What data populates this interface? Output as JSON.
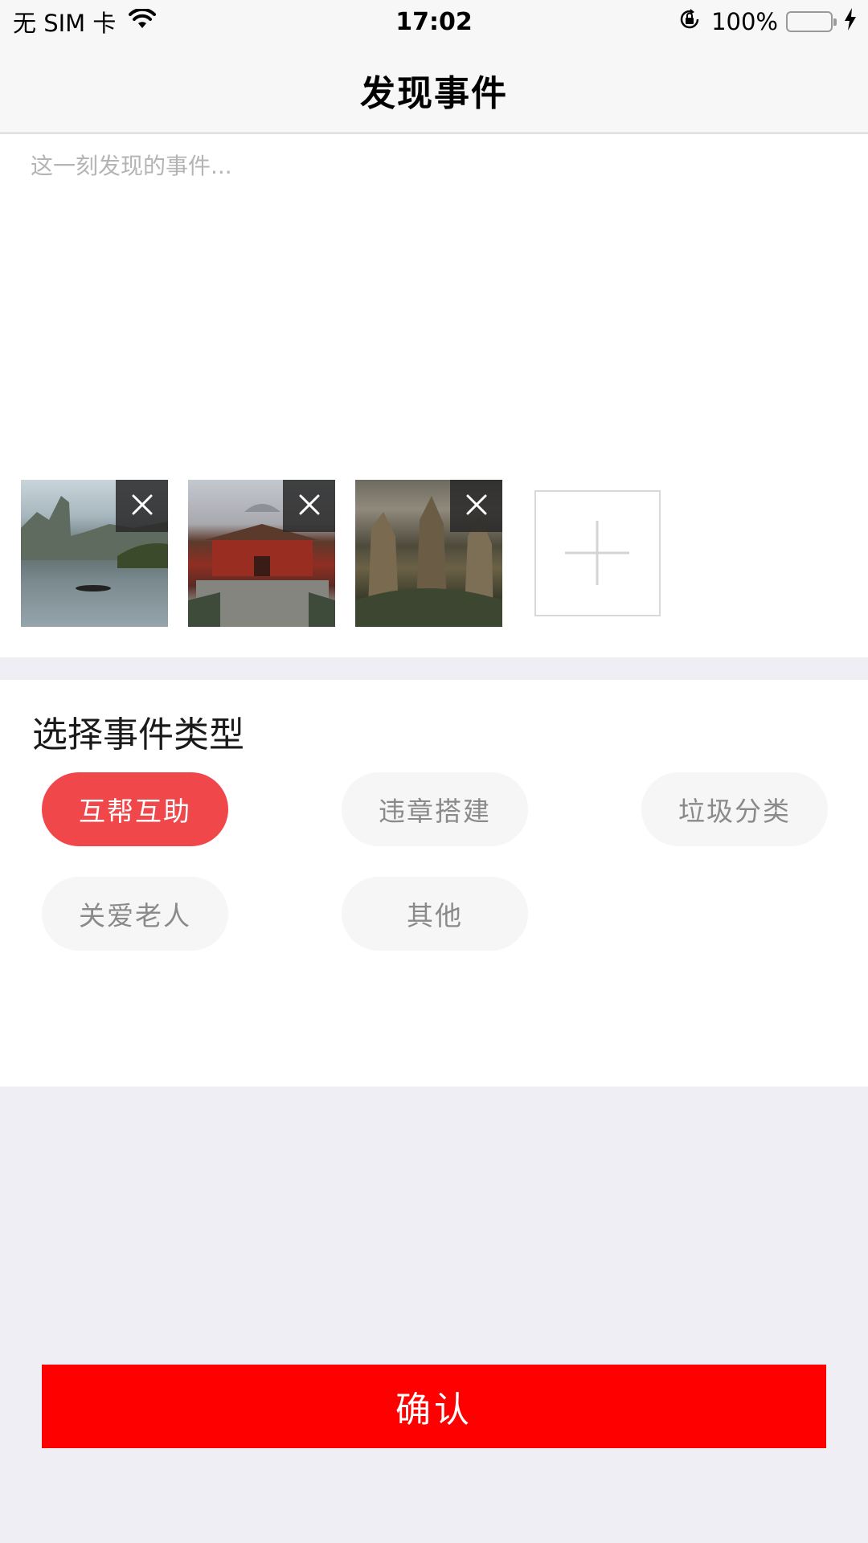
{
  "status_bar": {
    "carrier": "无 SIM 卡",
    "time": "17:02",
    "battery": "100%",
    "battery_level": 1.0,
    "battery_color": "#4cd964",
    "icons": [
      "wifi-icon",
      "orientation-lock-icon",
      "battery-icon",
      "charging-bolt-icon"
    ]
  },
  "nav": {
    "title": "发现事件"
  },
  "compose": {
    "placeholder": "这一刻发现的事件...",
    "value": "",
    "photos": [
      {
        "name": "lake-landscape-photo",
        "delete_icon": "close-icon"
      },
      {
        "name": "palace-photo",
        "delete_icon": "close-icon"
      },
      {
        "name": "mountain-pillars-photo",
        "delete_icon": "close-icon"
      }
    ],
    "add_icon": "plus-icon"
  },
  "event_types": {
    "title": "选择事件类型",
    "options": [
      {
        "label": "互帮互助",
        "selected": true
      },
      {
        "label": "违章搭建",
        "selected": false
      },
      {
        "label": "垃圾分类",
        "selected": false
      },
      {
        "label": "关爱老人",
        "selected": false
      },
      {
        "label": "其他",
        "selected": false
      }
    ]
  },
  "confirm": {
    "label": "确认"
  },
  "colors": {
    "accent_selected": "#f0474b",
    "confirm_bg": "#fe0000",
    "page_bg": "#efeef4"
  }
}
